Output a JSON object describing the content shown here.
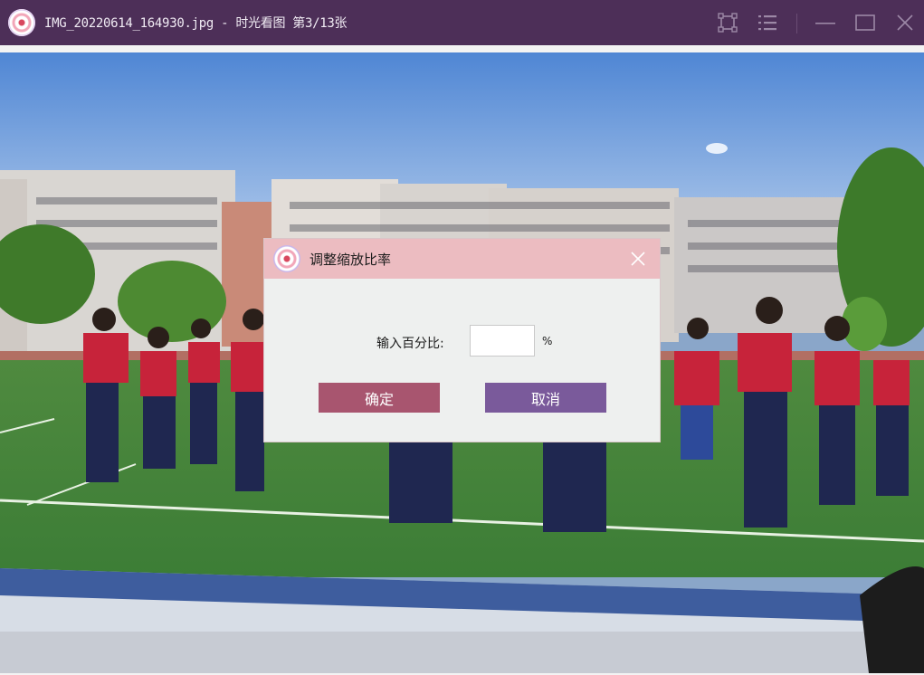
{
  "window": {
    "title": "IMG_20220614_164930.jpg - 时光看图 第3/13张",
    "icons": [
      "app-logo-icon",
      "fit-window-icon",
      "list-menu-icon",
      "minimize-icon",
      "maximize-icon",
      "close-icon"
    ]
  },
  "dialog": {
    "title": "调整缩放比率",
    "input_label": "输入百分比:",
    "input_value": "",
    "input_unit": "%",
    "ok_label": "确定",
    "cancel_label": "取消"
  },
  "colors": {
    "titlebar": "#4d2f58",
    "dialog_header": "#ecbcc1",
    "ok_button": "#a8556f",
    "cancel_button": "#7a5a9b"
  }
}
